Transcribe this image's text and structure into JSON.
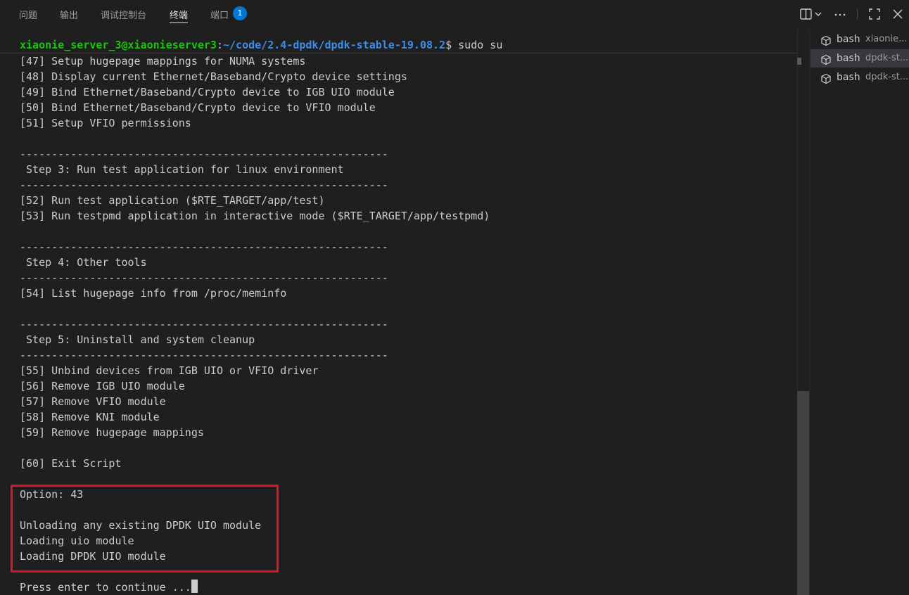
{
  "panel_tabs": [
    {
      "label": "问题"
    },
    {
      "label": "输出"
    },
    {
      "label": "调试控制台"
    },
    {
      "label": "终端"
    },
    {
      "label": "端口",
      "badge": "1"
    }
  ],
  "toolbar_icons": [
    "split-terminal-icon",
    "chevron-down-icon",
    "more-actions-icon",
    "maximize-panel-icon",
    "close-icon"
  ],
  "terminal": {
    "prompt": {
      "user": "xiaonie_server_3@xiaonieserver3",
      "sep": ":",
      "path": "~/code/2.4-dpdk/dpdk-stable-19.08.2",
      "cmd": "$ sudo su"
    },
    "lines": [
      "[47] Setup hugepage mappings for NUMA systems",
      "[48] Display current Ethernet/Baseband/Crypto device settings",
      "[49] Bind Ethernet/Baseband/Crypto device to IGB UIO module",
      "[50] Bind Ethernet/Baseband/Crypto device to VFIO module",
      "[51] Setup VFIO permissions",
      "",
      "----------------------------------------------------------",
      " Step 3: Run test application for linux environment",
      "----------------------------------------------------------",
      "[52] Run test application ($RTE_TARGET/app/test)",
      "[53] Run testpmd application in interactive mode ($RTE_TARGET/app/testpmd)",
      "",
      "----------------------------------------------------------",
      " Step 4: Other tools",
      "----------------------------------------------------------",
      "[54] List hugepage info from /proc/meminfo",
      "",
      "----------------------------------------------------------",
      " Step 5: Uninstall and system cleanup",
      "----------------------------------------------------------",
      "[55] Unbind devices from IGB UIO or VFIO driver",
      "[56] Remove IGB UIO module",
      "[57] Remove VFIO module",
      "[58] Remove KNI module",
      "[59] Remove hugepage mappings",
      "",
      "[60] Exit Script",
      "",
      "Option: 43",
      "",
      "Unloading any existing DPDK UIO module",
      "Loading uio module",
      "Loading DPDK UIO module",
      "",
      "Press enter to continue ..."
    ]
  },
  "side_terminals": [
    {
      "label": "bash",
      "sub": "xiaonie...",
      "active": false
    },
    {
      "label": "bash",
      "sub": "dpdk-st...",
      "active": true
    },
    {
      "label": "bash",
      "sub": "dpdk-st...",
      "active": false
    }
  ],
  "colors": {
    "background": "#1f1f1f",
    "prompt_user": "#16c60c",
    "prompt_path": "#3b8eea",
    "highlight_box": "#e81123",
    "badge": "#0078d4"
  }
}
